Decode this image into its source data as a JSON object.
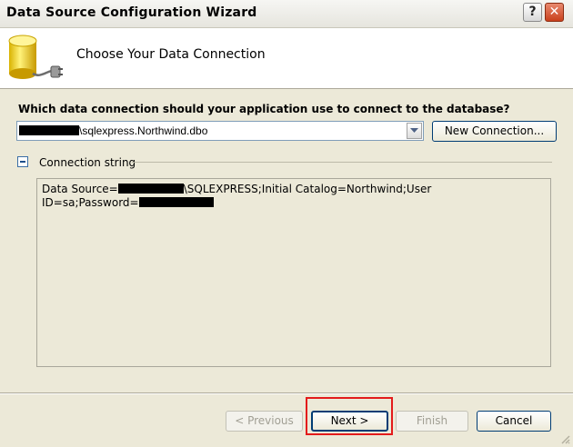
{
  "window": {
    "title": "Data Source Configuration Wizard"
  },
  "titlebar": {
    "help_glyph": "?",
    "close_glyph": "✕"
  },
  "header": {
    "title": "Choose Your Data Connection",
    "icon": "database-plug-icon"
  },
  "question": "Which data connection should your application use to connect to the database?",
  "connection_combo": {
    "selected_value": "\\sqlexpress.Northwind.dbo"
  },
  "new_connection_button": "New Connection...",
  "connection_string_section": {
    "label": "Connection string",
    "line1_prefix": "Data Source=",
    "line1_suffix": "\\SQLEXPRESS;Initial Catalog=Northwind;User",
    "line2_prefix": "ID=sa;Password="
  },
  "footer": {
    "previous_label": "< Previous",
    "next_label": "Next >",
    "finish_label": "Finish",
    "cancel_label": "Cancel"
  },
  "colors": {
    "dialog_bg": "#ece9d8",
    "highlight_border": "#e31b1b",
    "button_border": "#003c74"
  }
}
